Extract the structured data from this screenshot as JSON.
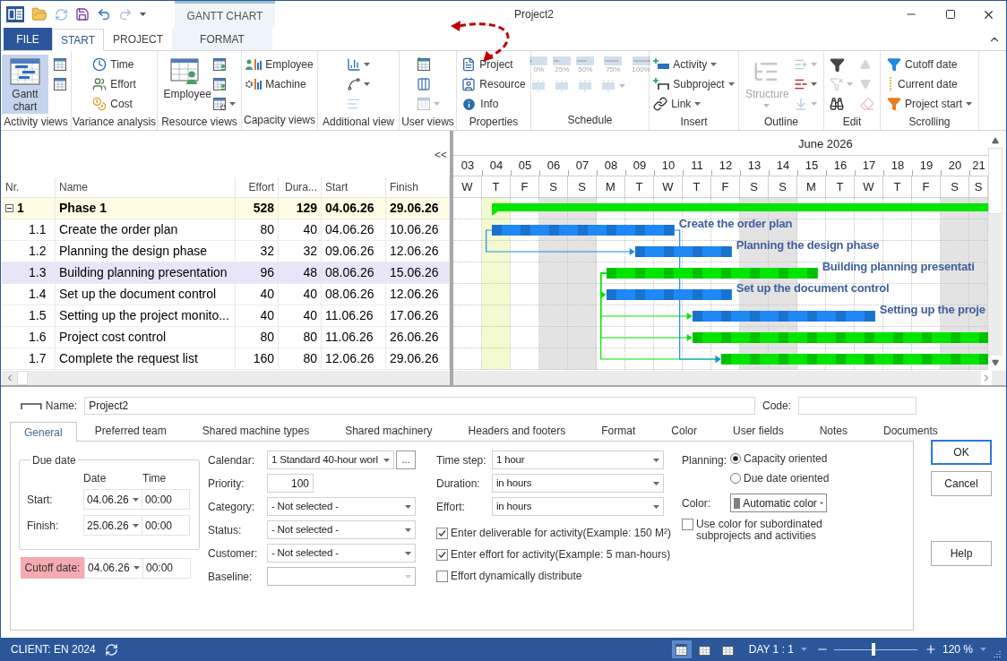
{
  "title_bar": {
    "title": "Project2",
    "context_label": "GANTT CHART"
  },
  "ribbon_tabs": [
    {
      "label": "FILE",
      "kind": "file",
      "selected": false
    },
    {
      "label": "START",
      "kind": "tab",
      "selected": true
    },
    {
      "label": "PROJECT",
      "kind": "tab",
      "selected": false
    },
    {
      "label": "FORMAT",
      "kind": "context",
      "selected": false
    }
  ],
  "ribbon_groups": [
    {
      "label": "Activity views",
      "columns": [
        [
          {
            "kind": "large",
            "label": "Gantt chart",
            "selected": true
          }
        ],
        [
          {
            "kind": "icon",
            "selected": false
          },
          {
            "kind": "icon",
            "selected": false
          }
        ]
      ]
    },
    {
      "label": "Variance analysis",
      "columns": [
        [
          {
            "kind": "small",
            "label": "Time"
          },
          {
            "kind": "small",
            "label": "Effort"
          },
          {
            "kind": "small",
            "label": "Cost"
          }
        ]
      ]
    },
    {
      "label": "Resource views",
      "columns": [
        [
          {
            "kind": "large",
            "label": "Employee"
          }
        ],
        [
          {
            "kind": "icon"
          },
          {
            "kind": "icon"
          },
          {
            "kind": "icon",
            "dropdown": true
          }
        ]
      ]
    },
    {
      "label": "Capacity views",
      "columns": [
        [
          {
            "kind": "small",
            "label": "Employee"
          },
          {
            "kind": "small",
            "label": "Machine"
          }
        ]
      ]
    },
    {
      "label": "Additional view",
      "columns": [
        [
          {
            "kind": "icon",
            "dropdown": true
          },
          {
            "kind": "icon",
            "dropdown": true
          },
          {
            "kind": "icon",
            "disabled": true
          }
        ]
      ]
    },
    {
      "label": "User views",
      "columns": [
        [
          {
            "kind": "icon"
          },
          {
            "kind": "icon"
          },
          {
            "kind": "icon",
            "dropdown": true,
            "disabled": true
          }
        ]
      ]
    },
    {
      "label": "Properties",
      "columns": [
        [
          {
            "kind": "small",
            "label": "Project"
          },
          {
            "kind": "small",
            "label": "Resource"
          },
          {
            "kind": "small",
            "label": "Info"
          }
        ]
      ]
    },
    {
      "label": "Schedule",
      "columns": [
        [
          {
            "kind": "progress",
            "label": "0%",
            "disabled": true
          },
          {
            "kind": "icon",
            "disabled": true
          }
        ],
        [
          {
            "kind": "progress",
            "label": "25%",
            "disabled": true
          },
          {
            "kind": "icon",
            "disabled": true
          }
        ],
        [
          {
            "kind": "progress",
            "label": "50%",
            "disabled": true
          },
          {
            "kind": "icon",
            "disabled": true
          }
        ],
        [
          {
            "kind": "progress",
            "label": "75%",
            "disabled": true
          },
          {
            "kind": "icon",
            "dropdown": true,
            "disabled": true
          }
        ],
        [
          {
            "kind": "progress",
            "label": "100%",
            "disabled": true
          }
        ]
      ]
    },
    {
      "label": "Insert",
      "columns": [
        [
          {
            "kind": "small",
            "label": "Activity",
            "dropdown": true
          },
          {
            "kind": "small",
            "label": "Subproject",
            "dropdown": true
          },
          {
            "kind": "small",
            "label": "Link",
            "dropdown": true
          }
        ]
      ]
    },
    {
      "label": "Outline",
      "columns": [
        [
          {
            "kind": "large",
            "label": "Structure",
            "dropdown": true,
            "disabled": true
          }
        ],
        [
          {
            "kind": "icon",
            "dropdown": true,
            "disabled": true
          },
          {
            "kind": "icon",
            "dropdown": true,
            "disabled": false
          },
          {
            "kind": "icon",
            "dropdown": true,
            "disabled": true
          }
        ]
      ]
    },
    {
      "label": "Edit",
      "columns": [
        [
          {
            "kind": "icon",
            "disabled": false
          },
          {
            "kind": "icon",
            "dropdown": true,
            "disabled": true
          },
          {
            "kind": "icon",
            "disabled": false
          }
        ],
        [
          {
            "kind": "icon",
            "disabled": true
          },
          {
            "kind": "icon",
            "disabled": true
          },
          {
            "kind": "icon",
            "disabled": true
          }
        ]
      ]
    },
    {
      "label": "Scrolling",
      "columns": [
        [
          {
            "kind": "small",
            "label": "Cutoff date"
          },
          {
            "kind": "small",
            "label": "Current date"
          },
          {
            "kind": "small",
            "label": "Project start",
            "dropdown": true
          }
        ]
      ]
    }
  ],
  "table": {
    "collapse_label": "<<",
    "columns": [
      "Nr.",
      "Name",
      "Effort",
      "Dura...",
      "Start",
      "Finish"
    ],
    "rows": [
      {
        "nr": "1",
        "name": "Phase 1",
        "effort": "528",
        "duration": "129",
        "start": "04.06.26",
        "finish": "29.06.26",
        "kind": "summary",
        "expanded": true,
        "selected": false,
        "color": "#00e600",
        "children": [
          {
            "nr": "1.1",
            "name": "Create the order plan",
            "effort": "80",
            "duration": "40",
            "start": "04.06.26",
            "finish": "10.06.26",
            "kind": "task",
            "selected": false,
            "color": "#1e88f5",
            "bar_label": "Create the order plan"
          },
          {
            "nr": "1.2",
            "name": "Planning the design phase",
            "effort": "32",
            "duration": "32",
            "start": "09.06.26",
            "finish": "12.06.26",
            "kind": "task",
            "selected": false,
            "color": "#1e88f5",
            "bar_label": "Planning the design phase"
          },
          {
            "nr": "1.3",
            "name": "Building planning presentation",
            "effort": "96",
            "duration": "48",
            "start": "08.06.26",
            "finish": "15.06.26",
            "kind": "task",
            "selected": true,
            "color": "#00e600",
            "bar_label": "Building planning presentati"
          },
          {
            "nr": "1.4",
            "name": "Set up the document control",
            "effort": "40",
            "duration": "40",
            "start": "08.06.26",
            "finish": "12.06.26",
            "kind": "task",
            "selected": false,
            "color": "#1e88f5",
            "bar_label": "Set up the document control"
          },
          {
            "nr": "1.5",
            "name": "Setting up the project monito...",
            "effort": "40",
            "duration": "40",
            "start": "11.06.26",
            "finish": "17.06.26",
            "kind": "task",
            "selected": false,
            "color": "#1e88f5",
            "bar_label": "Setting up the proje"
          },
          {
            "nr": "1.6",
            "name": "Project cost control",
            "effort": "80",
            "duration": "80",
            "start": "11.06.26",
            "finish": "26.06.26",
            "kind": "task",
            "selected": false,
            "color": "#00e600"
          },
          {
            "nr": "1.7",
            "name": "Complete the request list",
            "effort": "160",
            "duration": "80",
            "start": "12.06.26",
            "finish": "29.06.26",
            "kind": "task",
            "selected": false,
            "color": "#00e600"
          }
        ]
      }
    ]
  },
  "gantt": {
    "month": "June 2026",
    "days": [
      {
        "day": "03",
        "weekday": "W",
        "weekend": false,
        "today": false
      },
      {
        "day": "04",
        "weekday": "T",
        "weekend": false,
        "today": true
      },
      {
        "day": "05",
        "weekday": "F",
        "weekend": false,
        "today": false
      },
      {
        "day": "06",
        "weekday": "S",
        "weekend": true,
        "today": false
      },
      {
        "day": "07",
        "weekday": "S",
        "weekend": true,
        "today": false
      },
      {
        "day": "08",
        "weekday": "M",
        "weekend": false,
        "today": false
      },
      {
        "day": "09",
        "weekday": "T",
        "weekend": false,
        "today": false
      },
      {
        "day": "10",
        "weekday": "W",
        "weekend": false,
        "today": false
      },
      {
        "day": "11",
        "weekday": "T",
        "weekend": false,
        "today": false
      },
      {
        "day": "12",
        "weekday": "F",
        "weekend": false,
        "today": false
      },
      {
        "day": "13",
        "weekday": "S",
        "weekend": true,
        "today": false
      },
      {
        "day": "14",
        "weekday": "S",
        "weekend": true,
        "today": false
      },
      {
        "day": "15",
        "weekday": "M",
        "weekend": false,
        "today": false
      },
      {
        "day": "16",
        "weekday": "T",
        "weekend": false,
        "today": false
      },
      {
        "day": "17",
        "weekday": "W",
        "weekend": false,
        "today": false
      },
      {
        "day": "18",
        "weekday": "T",
        "weekend": false,
        "today": false
      },
      {
        "day": "19",
        "weekday": "F",
        "weekend": false,
        "today": false
      },
      {
        "day": "20",
        "weekday": "S",
        "weekend": true,
        "today": false
      },
      {
        "day": "21",
        "weekday": "S",
        "weekend": true,
        "today": false
      }
    ]
  },
  "properties": {
    "name_label": "Name:",
    "name": "Project2",
    "code_label": "Code:",
    "tabs": [
      {
        "label": "General",
        "selected": true
      },
      {
        "label": "Preferred team",
        "selected": false
      },
      {
        "label": "Shared machine types",
        "selected": false
      },
      {
        "label": "Shared machinery",
        "selected": false
      },
      {
        "label": "Headers and footers",
        "selected": false
      },
      {
        "label": "Format",
        "selected": false
      },
      {
        "label": "Color",
        "selected": false
      },
      {
        "label": "User fields",
        "selected": false
      },
      {
        "label": "Notes",
        "selected": false
      },
      {
        "label": "Documents",
        "selected": false
      }
    ],
    "due_date": {
      "title": "Due date",
      "date_header": "Date",
      "time_header": "Time",
      "rows": [
        {
          "label": "Start:",
          "date": "04.06.26",
          "time": "00:00"
        },
        {
          "label": "Finish:",
          "date": "25.06.26",
          "time": "00:00"
        }
      ]
    },
    "cutoff": {
      "label": "Cutoff date:",
      "date": "04.06.26",
      "time": "00:00",
      "highlighted": true
    },
    "fields": [
      {
        "label": "Calendar:",
        "value": "1 Standard 40-hour worl",
        "kind": "dropdown",
        "button": "..."
      },
      {
        "label": "Priority:",
        "value": "100",
        "kind": "number"
      },
      {
        "label": "Category:",
        "value": "- Not selected -",
        "kind": "dropdown"
      },
      {
        "label": "Status:",
        "value": "- Not selected -",
        "kind": "dropdown"
      },
      {
        "label": "Customer:",
        "value": "- Not selected -",
        "kind": "dropdown"
      },
      {
        "label": "Baseline:",
        "kind": "dropdown",
        "disabled": true
      }
    ],
    "settings": [
      {
        "label": "Time step:",
        "value": "1 hour"
      },
      {
        "label": "Duration:",
        "value": "in hours"
      },
      {
        "label": "Effort:",
        "value": "in hours"
      }
    ],
    "checks": [
      {
        "label": "Enter deliverable for activity(Example: 150 M²)",
        "checked": true
      },
      {
        "label": "Enter effort for activity(Example: 5 man-hours)",
        "checked": true
      },
      {
        "label": "Effort dynamically distribute",
        "checked": false
      }
    ],
    "planning": {
      "label": "Planning:",
      "options": [
        {
          "label": "Capacity oriented",
          "selected": true
        },
        {
          "label": "Due date oriented",
          "selected": false
        }
      ]
    },
    "color": {
      "label": "Color:",
      "value": "Automatic color"
    },
    "use_color": {
      "label": "Use color for subordinated subprojects and activities",
      "checked": false
    },
    "buttons": [
      {
        "label": "OK",
        "kind": "default"
      },
      {
        "label": "Cancel",
        "kind": "normal"
      },
      {
        "label": "Help",
        "kind": "help"
      }
    ]
  },
  "status_bar": {
    "client": "CLIENT: EN 2024",
    "view_buttons": [
      {
        "selected": true
      },
      {
        "selected": false
      },
      {
        "selected": false
      }
    ],
    "scale": "DAY 1 : 1",
    "zoom": {
      "value": "120 %",
      "level": 0.47
    }
  }
}
